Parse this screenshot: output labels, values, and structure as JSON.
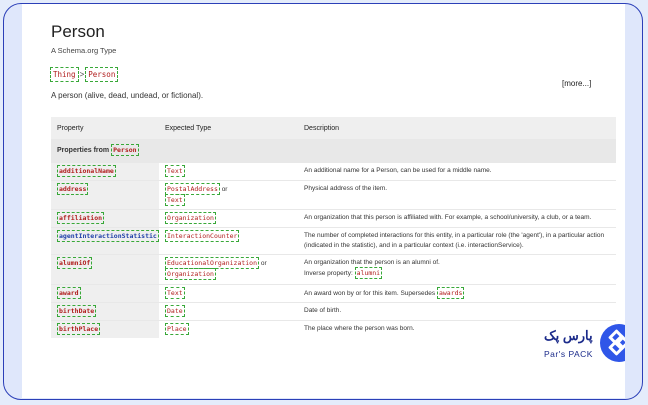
{
  "header": {
    "title": "Person",
    "subtitle": "A Schema.org Type",
    "breadcrumbs": [
      "Thing",
      "Person"
    ],
    "breadcrumb_sep": ">",
    "more": "[more...]",
    "description": "A person (alive, dead, undead, or fictional)."
  },
  "table": {
    "headers": [
      "Property",
      "Expected Type",
      "Description"
    ],
    "section_label": "Properties from",
    "section_type": "Person",
    "rows": [
      {
        "prop": "additionalName",
        "types": [
          "Text"
        ],
        "desc": "An additional name for a Person, can be used for a middle name."
      },
      {
        "prop": "address",
        "types": [
          "PostalAddress",
          "Text"
        ],
        "desc": "Physical address of the item."
      },
      {
        "prop": "affiliation",
        "types": [
          "Organization"
        ],
        "desc": "An organization that this person is affiliated with. For example, a school/university, a club, or a team."
      },
      {
        "prop": "agentInteractionStatistic",
        "types": [
          "InteractionCounter"
        ],
        "desc": "The number of completed interactions for this entity, in a particular role (the 'agent'), in a particular action (indicated in the statistic), and in a particular context (i.e. interactionService)."
      },
      {
        "prop": "alumniOf",
        "types": [
          "EducationalOrganization",
          "Organization"
        ],
        "desc": "An organization that the person is an alumni of.",
        "inverse_label": "Inverse property:",
        "inverse_value": "alumni"
      },
      {
        "prop": "award",
        "types": [
          "Text"
        ],
        "desc": "An award won by or for this item. Supersedes",
        "supersedes": "awards"
      },
      {
        "prop": "birthDate",
        "types": [
          "Date"
        ],
        "desc": "Date of birth."
      },
      {
        "prop": "birthPlace",
        "types": [
          "Place"
        ],
        "desc": "The place where the person was born."
      }
    ],
    "or_word": "or"
  },
  "logo": {
    "brand_fa": "پارس پک",
    "brand_en": "Par's PACK",
    "accent": "#2f56e8",
    "icon": "parspack-logo-icon"
  },
  "colors": {
    "code_red": "#b01c1c",
    "code_blue": "#1e3fa8",
    "dashed_green": "#38a838",
    "frame_blue": "#2b3fb8"
  }
}
